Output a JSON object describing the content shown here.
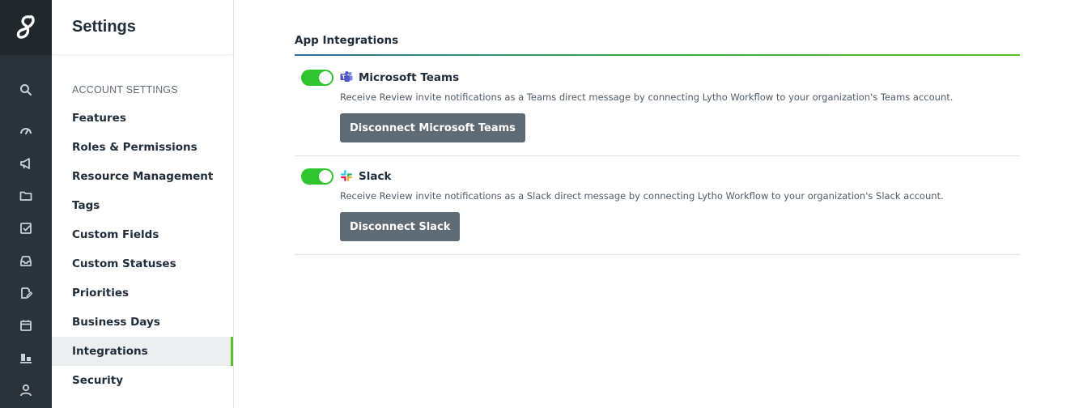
{
  "rail": {
    "logo": "lytho-logo",
    "icons": [
      "search-icon",
      "gauge-icon",
      "megaphone-icon",
      "folder-icon",
      "task-check-icon",
      "inbox-icon",
      "edit-document-icon",
      "calendar-icon",
      "chart-icon",
      "user-icon"
    ]
  },
  "sidebar": {
    "title": "Settings",
    "section_label": "ACCOUNT SETTINGS",
    "items": [
      {
        "label": "Features"
      },
      {
        "label": "Roles & Permissions"
      },
      {
        "label": "Resource Management"
      },
      {
        "label": "Tags"
      },
      {
        "label": "Custom Fields"
      },
      {
        "label": "Custom Statuses"
      },
      {
        "label": "Priorities"
      },
      {
        "label": "Business Days"
      },
      {
        "label": "Integrations",
        "active": true
      },
      {
        "label": "Security"
      }
    ]
  },
  "main": {
    "section_title": "App Integrations",
    "integrations": [
      {
        "name": "Microsoft Teams",
        "icon": "microsoft-teams-icon",
        "enabled": true,
        "description": "Receive Review invite notifications as a Teams direct message by connecting Lytho Workflow to your organization's Teams account.",
        "button_label": "Disconnect Microsoft Teams"
      },
      {
        "name": "Slack",
        "icon": "slack-icon",
        "enabled": true,
        "description": "Receive Review invite notifications as a Slack direct message by connecting Lytho Workflow to your organization's Slack account.",
        "button_label": "Disconnect Slack"
      }
    ]
  },
  "colors": {
    "rail_bg": "#2b333a",
    "toggle_on": "#2ec52f",
    "active_indicator": "#5fbd2e",
    "button_bg": "#5f6b74"
  }
}
